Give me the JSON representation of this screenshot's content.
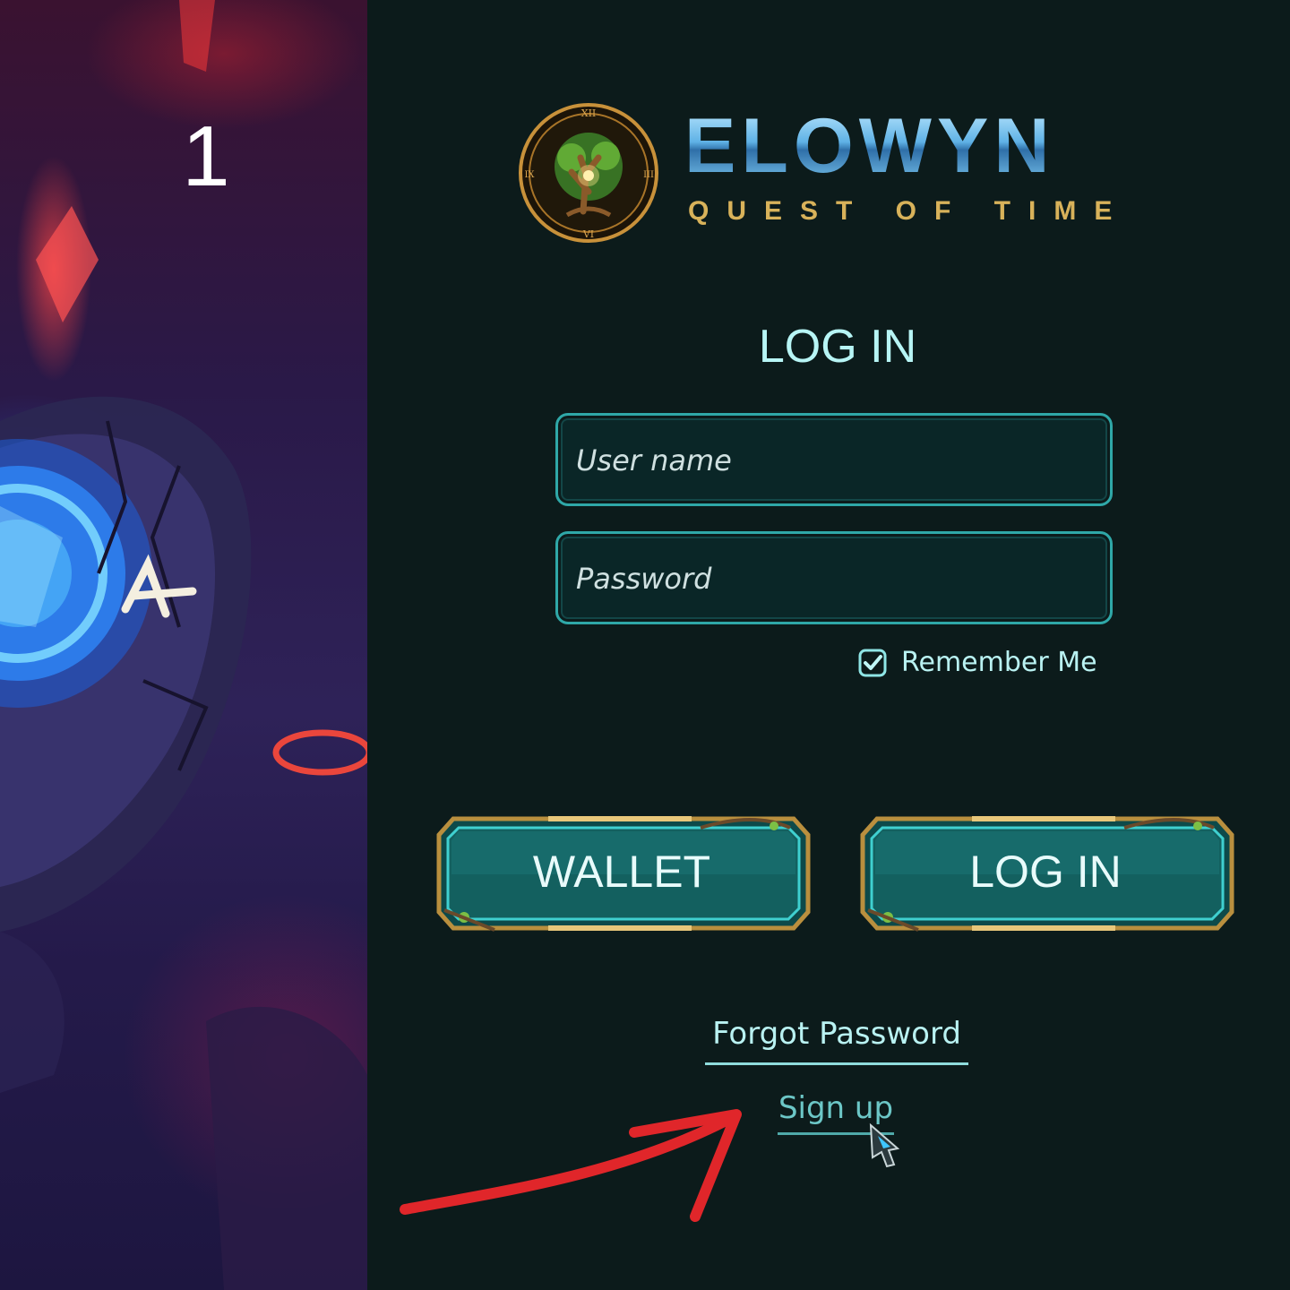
{
  "step": {
    "number": "1"
  },
  "brand": {
    "title": "ELOWYN",
    "subtitle": "QUEST OF TIME",
    "emblem_icon": "tree-clock-emblem-icon",
    "emblem_numerals": [
      "XII",
      "III",
      "VI",
      "IX"
    ]
  },
  "login": {
    "heading": "LOG IN",
    "username_placeholder": "User name",
    "password_placeholder": "Password",
    "remember_label": "Remember Me",
    "remember_checked": true
  },
  "buttons": {
    "wallet_label": "WALLET",
    "login_label": "LOG IN"
  },
  "links": {
    "forgot": "Forgot Password",
    "signup": "Sign up"
  },
  "colors": {
    "panel_bg": "#0c1b1b",
    "accent_teal": "#2fa8a8",
    "text_cyan": "#b9f2f2",
    "gold": "#d8b25a",
    "arrow_red": "#e0262a"
  },
  "icons": {
    "cursor": "crystal-cursor-icon",
    "annotation": "red-curved-arrow-icon",
    "checkbox": "checkbox-checked-icon"
  }
}
